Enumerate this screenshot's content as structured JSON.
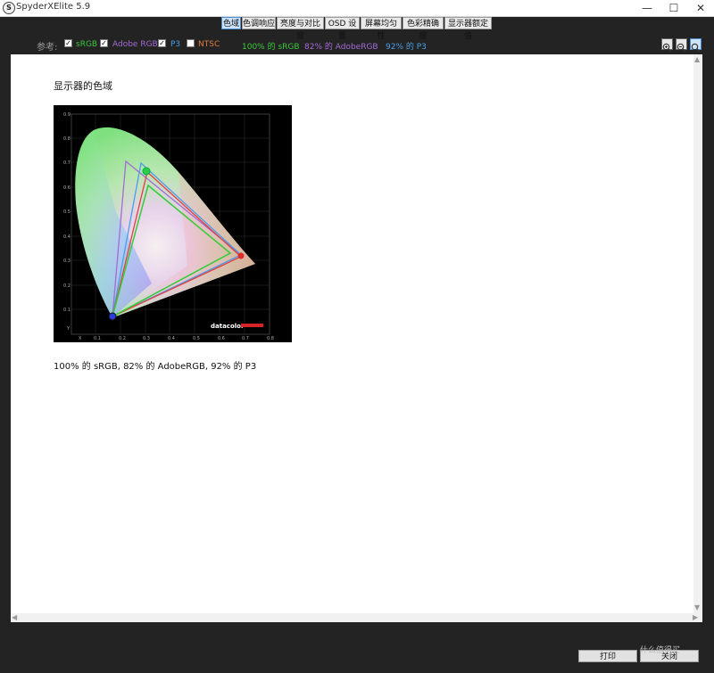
{
  "window": {
    "logo_letter": "S",
    "title": "SpyderXElite 5.9",
    "minimize": "—",
    "maximize": "☐",
    "close": "✕"
  },
  "tabs": [
    {
      "label": "色域",
      "active": true
    },
    {
      "label": "色调响应",
      "active": false
    },
    {
      "label": "亮度与对比度",
      "active": false
    },
    {
      "label": "OSD 设置",
      "active": false
    },
    {
      "label": "屏幕均匀性",
      "active": false
    },
    {
      "label": "色彩精确度",
      "active": false
    },
    {
      "label": "显示器额定值",
      "active": false
    }
  ],
  "reference": {
    "label": "参考:",
    "options": [
      {
        "label": "sRGB",
        "checked": true,
        "color": "#39c93b"
      },
      {
        "label": "Adobe RGB",
        "checked": true,
        "color": "#a46bd6"
      },
      {
        "label": "P3",
        "checked": true,
        "color": "#4a9ee6"
      },
      {
        "label": "NTSC",
        "checked": false,
        "color": "#e07b39"
      }
    ],
    "stats": [
      {
        "text": "100% 的 sRGB",
        "color": "#39c93b"
      },
      {
        "text": "82% 的 AdobeRGB",
        "color": "#a46bd6"
      },
      {
        "text": "92% 的 P3",
        "color": "#4a9ee6"
      }
    ]
  },
  "zoom": {
    "zoom_in": "zoom-in-icon",
    "zoom_out": "zoom-out-icon",
    "zoom_fit": "zoom-fit-icon"
  },
  "content": {
    "heading": "显示器的色域",
    "summary": "100% 的 sRGB, 82% 的 AdobeRGB, 92% 的 P3",
    "chart": {
      "x_ticks": [
        "X",
        "0.1",
        "0.2",
        "0.3",
        "0.4",
        "0.5",
        "0.6",
        "0.7",
        "0.8"
      ],
      "y_ticks": [
        "Y",
        "0.1",
        "0.2",
        "0.3",
        "0.4",
        "0.5",
        "0.6",
        "0.7",
        "0.8",
        "0.9"
      ],
      "brand": "datacolor"
    }
  },
  "buttons": {
    "print": "打印",
    "close": "关闭"
  },
  "watermark": "什么值得买"
}
